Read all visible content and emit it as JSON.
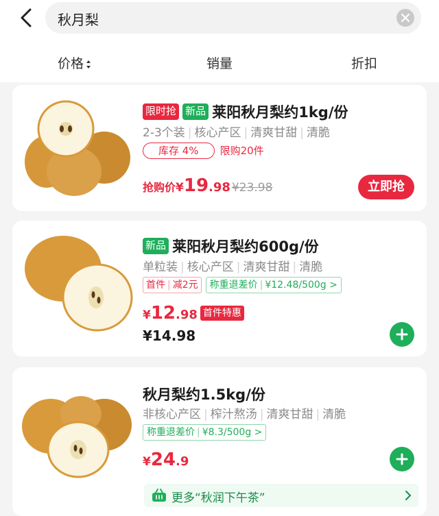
{
  "search": {
    "query": "秋月梨"
  },
  "sort_tabs": [
    {
      "label": "价格"
    },
    {
      "label": "销量"
    },
    {
      "label": "折扣"
    }
  ],
  "products": [
    {
      "tags": [
        "限时抢",
        "新品"
      ],
      "title": "莱阳秋月梨约1kg/份",
      "attributes": [
        "2-3个装",
        "核心产区",
        "清爽甘甜",
        "清脆"
      ],
      "stock_label": "库存 4%",
      "stock_fraction": 0.04,
      "limit_label": "限购20件",
      "deal_label": "抢购价",
      "currency": "¥",
      "price_int": "19",
      "price_dec": ".98",
      "original_price": "¥23.98",
      "button_label": "立即抢"
    },
    {
      "tags": [
        "新品"
      ],
      "title": "莱阳秋月梨约600g/份",
      "attributes": [
        "单粒装",
        "核心产区",
        "清爽甘甜",
        "清脆"
      ],
      "coupon": {
        "left": "首件",
        "right": "减2元"
      },
      "weight_refund": {
        "label": "称重退差价",
        "value": "¥12.48/500g"
      },
      "currency": "¥",
      "price_int": "12",
      "price_dec": ".98",
      "first_badge": "首件特惠",
      "regular_price": "¥14.98"
    },
    {
      "tags": [],
      "title": "秋月梨约1.5kg/份",
      "attributes": [
        "非核心产区",
        "榨汁熬汤",
        "清爽甘甜",
        "清脆"
      ],
      "weight_refund": {
        "label": "称重退差价",
        "value": "¥8.3/500g"
      },
      "currency": "¥",
      "price_int": "24",
      "price_dec": ".9",
      "more_label": "更多“秋润下午茶”"
    }
  ],
  "colors": {
    "accent_red": "#e8283f",
    "accent_green": "#1fae5a",
    "pear_skin": "#d89a3a",
    "pear_flesh": "#fbf4df"
  }
}
